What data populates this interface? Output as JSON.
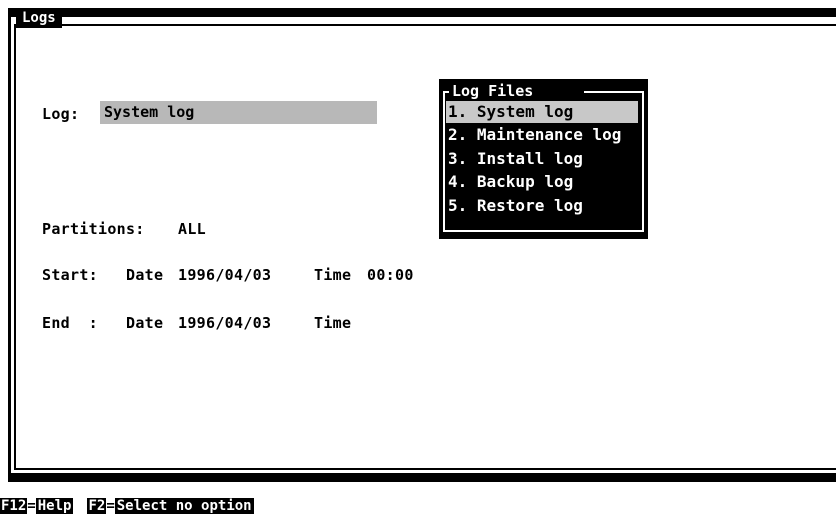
{
  "window": {
    "title": "Logs"
  },
  "form": {
    "log_label": "Log:",
    "log_value": "System log",
    "partitions_label": "Partitions:",
    "partitions_value": "ALL",
    "start_label": "Start:",
    "start_date_label": "Date",
    "start_date_value": "1996/04/03",
    "start_time_label": "Time",
    "start_time_value": "00:00",
    "end_label": "End  :",
    "end_date_label": "Date",
    "end_date_value": "1996/04/03",
    "end_time_label": "Time",
    "end_time_value": ""
  },
  "popup": {
    "title": "Log Files",
    "items": [
      {
        "label": "1. System log",
        "selected": true
      },
      {
        "label": "2. Maintenance log",
        "selected": false
      },
      {
        "label": "3. Install log",
        "selected": false
      },
      {
        "label": "4. Backup log",
        "selected": false
      },
      {
        "label": "5. Restore log",
        "selected": false
      }
    ]
  },
  "statusbar": {
    "keys": [
      {
        "key": "F12",
        "sep": "=",
        "desc": "Help"
      },
      {
        "key": "F2",
        "sep": "=",
        "desc": "Select no option"
      }
    ]
  },
  "colors": {
    "background": "#ffffff",
    "foreground": "#000000",
    "highlight": "#b8b8b8"
  }
}
